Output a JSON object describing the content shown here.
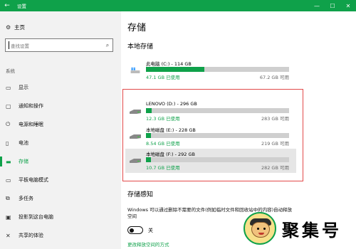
{
  "titlebar": {
    "back": "←",
    "title": "设置",
    "min": "—",
    "max": "☐",
    "close": "✕",
    "accent": "#0fa14a"
  },
  "sidebar": {
    "home": {
      "icon": "gear-icon",
      "label": "主页"
    },
    "search": {
      "placeholder": "查找设置",
      "icon": "search-icon"
    },
    "section": "系统",
    "items": [
      {
        "icon": "monitor-icon",
        "label": "显示"
      },
      {
        "icon": "notification-icon",
        "label": "通知和操作"
      },
      {
        "icon": "power-icon",
        "label": "电源和睡眠"
      },
      {
        "icon": "battery-icon",
        "label": "电池"
      },
      {
        "icon": "storage-icon",
        "label": "存储"
      },
      {
        "icon": "tablet-icon",
        "label": "平板电脑模式"
      },
      {
        "icon": "multitask-icon",
        "label": "多任务"
      },
      {
        "icon": "project-icon",
        "label": "投影到这台电脑"
      },
      {
        "icon": "share-icon",
        "label": "共享的体验"
      }
    ],
    "active_index": 4
  },
  "main": {
    "title": "存储",
    "local_storage": "本地存储",
    "drives": [
      {
        "name": "此电脑 (C:) - 114 GB",
        "used": "47.1 GB 已使用",
        "available": "67.2 GB 可用",
        "fraction_used": 0.41,
        "icon": "windows-drive-icon"
      },
      {
        "name": "LENOVO (D:) - 296 GB",
        "used": "12.3 GB 已使用",
        "available": "283 GB 可用",
        "fraction_used": 0.04,
        "icon": "drive-icon"
      },
      {
        "name": "本地磁盘 (E:) - 228 GB",
        "used": "8.54 GB 已使用",
        "available": "219 GB 可用",
        "fraction_used": 0.037,
        "icon": "drive-icon"
      },
      {
        "name": "本地磁盘 (F:) - 292 GB",
        "used": "10.7 GB 已使用",
        "available": "282 GB 可用",
        "fraction_used": 0.037,
        "icon": "drive-icon"
      }
    ],
    "storage_sense": "存储感知",
    "description": "Windows 可以通过删除不需要的文件(例如临时文件和回收站中的内容)自动释放空间",
    "toggle_state": "关",
    "link": "更改释放空间的方式"
  },
  "watermark": {
    "text": "聚集号"
  }
}
